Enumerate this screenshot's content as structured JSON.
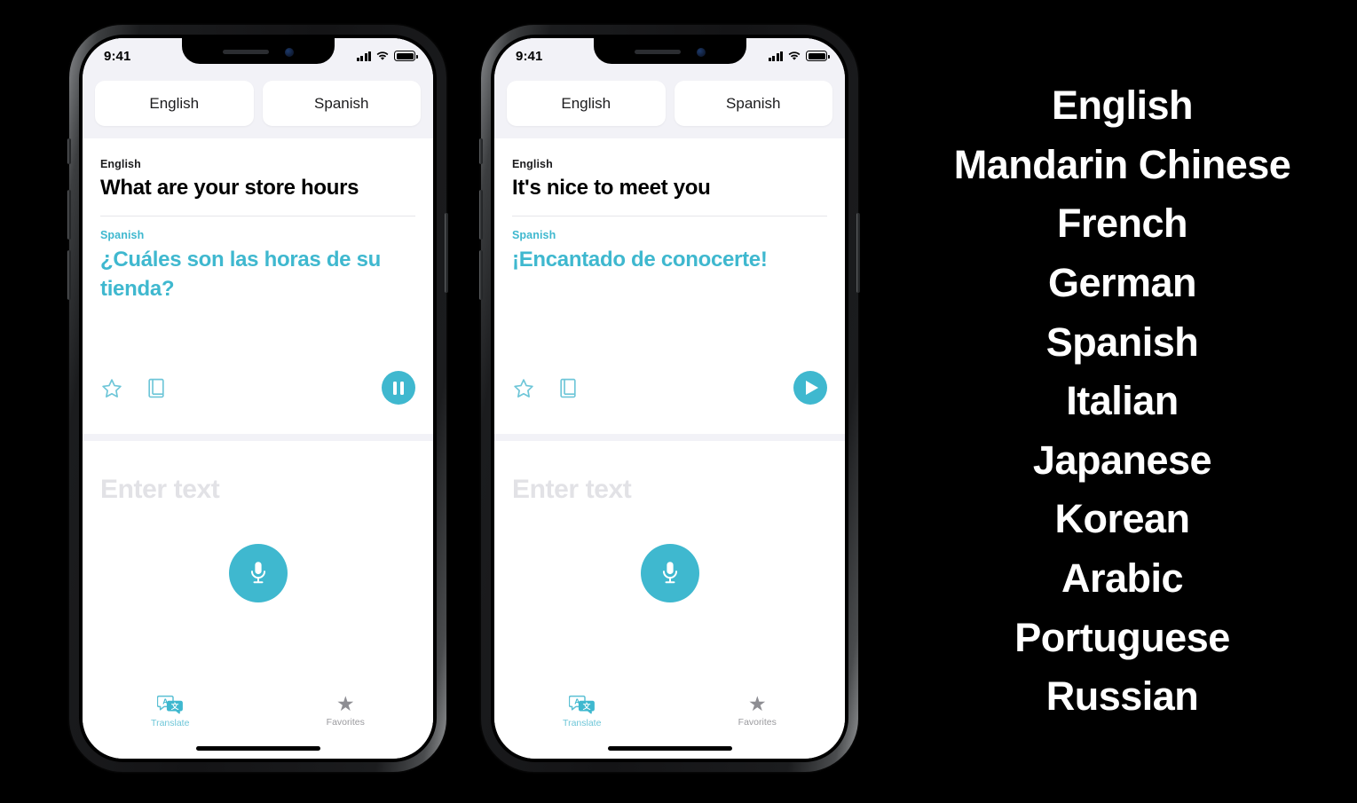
{
  "accent_color": "#3fb8cf",
  "background_color": "#000000",
  "phones": [
    {
      "id": "phone-left",
      "status_bar": {
        "time": "9:41",
        "signal_icon": "cellular-bars-icon",
        "wifi_icon": "wifi-icon",
        "battery_icon": "battery-full-icon"
      },
      "language_selector": {
        "source_label": "English",
        "target_label": "Spanish"
      },
      "translation_card": {
        "source_language_label": "English",
        "source_text": "What are your store hours",
        "target_language_label": "Spanish",
        "target_text": "¿Cuáles son las horas de su tienda?",
        "actions": {
          "favorite_icon": "star-outline-icon",
          "dictionary_icon": "book-icon",
          "playback_icon": "pause-icon",
          "playback_state": "playing"
        }
      },
      "input_area": {
        "placeholder": "Enter text",
        "mic_icon": "microphone-icon"
      },
      "tab_bar": {
        "tabs": [
          {
            "label": "Translate",
            "icon": "translate-bubbles-icon",
            "active": true
          },
          {
            "label": "Favorites",
            "icon": "star-filled-icon",
            "active": false
          }
        ]
      }
    },
    {
      "id": "phone-right",
      "status_bar": {
        "time": "9:41",
        "signal_icon": "cellular-bars-icon",
        "wifi_icon": "wifi-icon",
        "battery_icon": "battery-full-icon"
      },
      "language_selector": {
        "source_label": "English",
        "target_label": "Spanish"
      },
      "translation_card": {
        "source_language_label": "English",
        "source_text": "It's nice to meet you",
        "target_language_label": "Spanish",
        "target_text": "¡Encantado de conocerte!",
        "actions": {
          "favorite_icon": "star-outline-icon",
          "dictionary_icon": "book-icon",
          "playback_icon": "play-icon",
          "playback_state": "paused"
        }
      },
      "input_area": {
        "placeholder": "Enter text",
        "mic_icon": "microphone-icon"
      },
      "tab_bar": {
        "tabs": [
          {
            "label": "Translate",
            "icon": "translate-bubbles-icon",
            "active": true
          },
          {
            "label": "Favorites",
            "icon": "star-filled-icon",
            "active": false
          }
        ]
      }
    }
  ],
  "supported_languages": [
    "English",
    "Mandarin Chinese",
    "French",
    "German",
    "Spanish",
    "Italian",
    "Japanese",
    "Korean",
    "Arabic",
    "Portuguese",
    "Russian"
  ]
}
